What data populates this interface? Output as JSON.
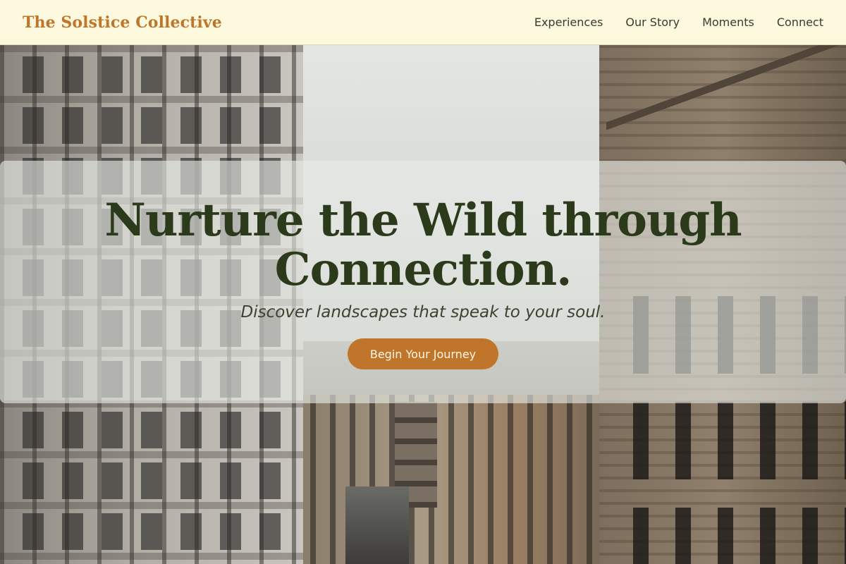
{
  "header": {
    "brand": "The Solstice Collective",
    "nav": [
      "Experiences",
      "Our Story",
      "Moments",
      "Connect"
    ]
  },
  "hero": {
    "title": "Nurture the Wild through Connection.",
    "subtitle": "Discover landscapes that speak to your soul.",
    "cta_label": "Begin Your Journey"
  },
  "colors": {
    "accent": "#c0762a",
    "header_bg": "#fffbde",
    "title": "#2c3a1c"
  }
}
